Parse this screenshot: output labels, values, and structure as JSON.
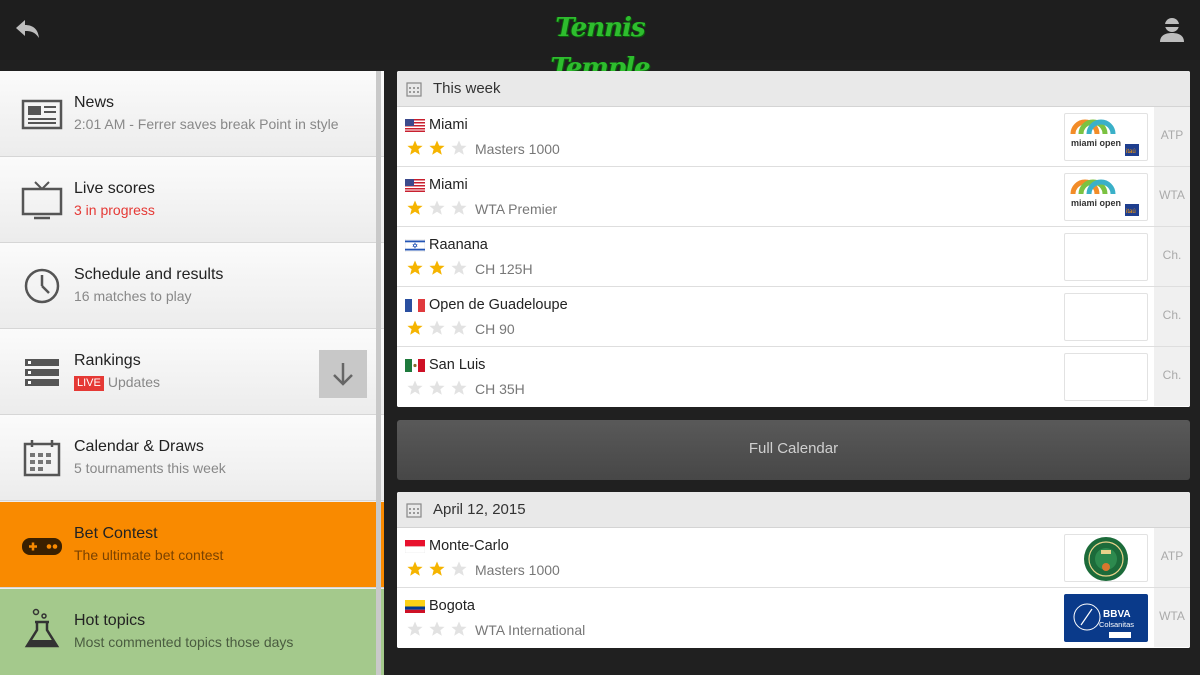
{
  "app": {
    "logo_text": "Tennis Temple"
  },
  "drawer": {
    "items": [
      {
        "title": "News",
        "subtitle": "2:01 AM - Ferrer saves break Point in style",
        "icon": "newspaper-icon"
      },
      {
        "title": "Live scores",
        "subtitle": "3 in progress",
        "icon": "tv-icon"
      },
      {
        "title": "Schedule and results",
        "subtitle": "16 matches to play",
        "icon": "clock-icon"
      },
      {
        "title": "Rankings",
        "badge": "LIVE",
        "subtitle": "Updates",
        "icon": "list-icon"
      },
      {
        "title": "Calendar & Draws",
        "subtitle": "5 tournaments this week",
        "icon": "calendar-icon"
      },
      {
        "title": "Bet Contest",
        "subtitle": "The ultimate bet contest",
        "icon": "gamepad-icon"
      },
      {
        "title": "Hot topics",
        "subtitle": "Most commented topics those days",
        "icon": "flask-icon"
      }
    ]
  },
  "this_week": {
    "header": "This week",
    "rows": [
      {
        "name": "Miami",
        "flag": "us-flag-icon",
        "stars": 2,
        "category": "Masters 1000",
        "tour": "ATP",
        "logo": "miami-open-logo"
      },
      {
        "name": "Miami",
        "flag": "us-flag-icon",
        "stars": 1,
        "category": "WTA Premier",
        "tour": "WTA",
        "logo": "miami-open-logo"
      },
      {
        "name": "Raanana",
        "flag": "israel-flag-icon",
        "stars": 2,
        "category": "CH 125H",
        "tour": "Ch.",
        "logo": ""
      },
      {
        "name": "Open de Guadeloupe",
        "flag": "france-flag-icon",
        "stars": 1,
        "category": "CH 90",
        "tour": "Ch.",
        "logo": ""
      },
      {
        "name": "San Luis",
        "flag": "mexico-flag-icon",
        "stars": 0,
        "category": "CH 35H",
        "tour": "Ch.",
        "logo": ""
      }
    ]
  },
  "full_calendar_label": "Full Calendar",
  "april": {
    "header": "April 12, 2015",
    "rows": [
      {
        "name": "Monte-Carlo",
        "flag": "monaco-flag-icon",
        "stars": 2,
        "category": "Masters 1000",
        "tour": "ATP",
        "logo": "monte-carlo-logo"
      },
      {
        "name": "Bogota",
        "flag": "colombia-flag-icon",
        "stars": 0,
        "category": "WTA International",
        "tour": "WTA",
        "logo": "bbva-colsanitas-logo"
      }
    ]
  },
  "logo_texts": {
    "miami_open": "miami open",
    "itau": "itaú",
    "bbva": "BBVA",
    "colsanitas": "Colsanitas"
  },
  "colors": {
    "accent_orange": "#f98a00",
    "accent_green": "#a4c98c",
    "star_gold": "#f5b400",
    "logo_green": "#2ebd2e"
  }
}
